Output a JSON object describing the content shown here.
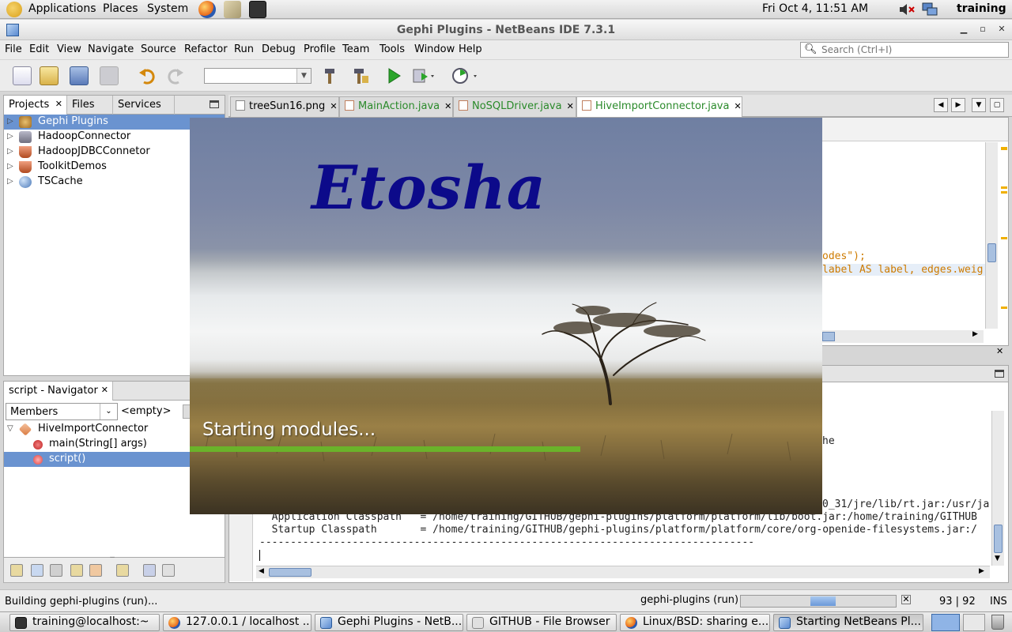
{
  "top_panel": {
    "menus": [
      "Applications",
      "Places",
      "System"
    ],
    "clock": "Fri Oct  4, 11:51 AM",
    "user": "training"
  },
  "window": {
    "title": "Gephi Plugins - NetBeans IDE 7.3.1"
  },
  "menu_bar": {
    "items": [
      "File",
      "Edit",
      "View",
      "Navigate",
      "Source",
      "Refactor",
      "Run",
      "Debug",
      "Profile",
      "Team",
      "Tools",
      "Window",
      "Help"
    ],
    "search_placeholder": "Search (Ctrl+I)"
  },
  "projects_panel": {
    "tabs": [
      "Projects",
      "Files",
      "Services"
    ],
    "tree": [
      "Gephi Plugins",
      "HadoopConnector",
      "HadoopJDBCConnetor",
      "ToolkitDemos",
      "TSCache"
    ]
  },
  "navigator": {
    "title": "script - Navigator",
    "filter": "Members",
    "empty_label": "<empty>",
    "tree": [
      "HiveImportConnector",
      "main(String[] args)",
      "script()"
    ]
  },
  "editor": {
    "tabs": [
      "treeSun16.png",
      "MainAction.java",
      "NoSQLDriver.java",
      "HiveImportConnector.java"
    ],
    "code_lines": [
      "odes\");",
      "label AS label, edges.weig"
    ]
  },
  "output": {
    "lines": [
      "he",
      "0_31/jre/lib/rt.jar:/usr/ja",
      "  Application Classpath   = /home/training/GITHUB/gephi-plugins/platform/platform/lib/boot.jar:/home/training/GITHUB",
      "  Startup Classpath       = /home/training/GITHUB/gephi-plugins/platform/platform/core/org-openide-filesystems.jar:/",
      "--------------------------------------------------------------------------------"
    ]
  },
  "splash": {
    "title": "Etosha",
    "status": "Starting modules...",
    "progress": 0.618
  },
  "status_bar": {
    "message": "Building gephi-plugins (run)...",
    "task": "gephi-plugins (run)",
    "position": "93 | 92",
    "mode": "INS",
    "progress": 0.5
  },
  "taskbar": {
    "items": [
      "training@localhost:~",
      "127.0.0.1 / localhost ...",
      "Gephi Plugins - NetB...",
      "GITHUB - File Browser",
      "Linux/BSD: sharing e...",
      "Starting NetBeans Pl..."
    ]
  },
  "colors": {
    "selection": "#6a93d0",
    "splash_title": "#0c0a8a",
    "splash_bar": "#6ab32a",
    "code_string": "#ce7b00"
  }
}
